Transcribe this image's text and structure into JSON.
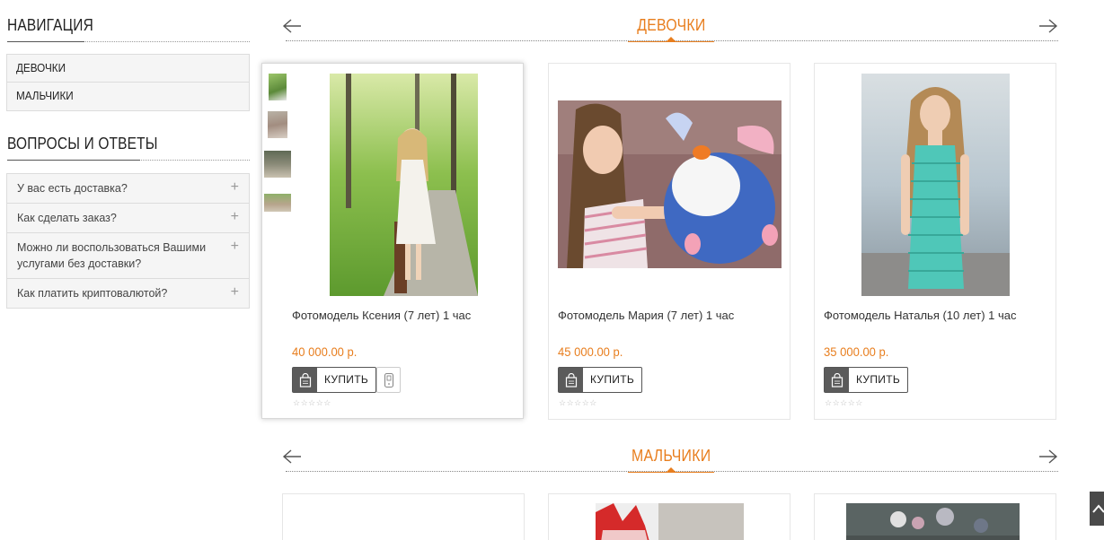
{
  "sidebar": {
    "nav_heading": "НАВИГАЦИЯ",
    "nav_items": [
      {
        "label": "ДЕВОЧКИ"
      },
      {
        "label": "МАЛЬЧИКИ"
      }
    ],
    "faq_heading": "ВОПРОСЫ И ОТВЕТЫ",
    "faq_items": [
      {
        "question": "У вас есть доставка?",
        "icon": "plus-icon"
      },
      {
        "question": "Как сделать заказ?",
        "icon": "plus-icon"
      },
      {
        "question": "Можно ли воспользоваться Вашими услугами без доставки?",
        "icon": "plus-icon"
      },
      {
        "question": "Как платить криптовалютой?",
        "icon": "plus-icon"
      }
    ]
  },
  "sections": [
    {
      "title": "ДЕВОЧКИ",
      "products": [
        {
          "name": "Фотомодель Ксения (7 лет) 1 час",
          "price": "40 000.00 р.",
          "buy_label": "КУПИТЬ",
          "rating": 0,
          "stars": "☆☆☆☆☆"
        },
        {
          "name": "Фотомодель Мария (7 лет) 1 час",
          "price": "45 000.00 р.",
          "buy_label": "КУПИТЬ",
          "rating": 0,
          "stars": "☆☆☆☆☆"
        },
        {
          "name": "Фотомодель Наталья (10 лет) 1 час",
          "price": "35 000.00 р.",
          "buy_label": "КУПИТЬ",
          "rating": 0,
          "stars": "☆☆☆☆☆"
        }
      ]
    },
    {
      "title": "МАЛЬЧИКИ",
      "products": []
    }
  ],
  "icons": {
    "prev": "arrow-left-icon",
    "next": "arrow-right-icon",
    "cart": "shopping-bag-icon",
    "compare": "compare-icon",
    "scroll_top": "chevron-up-icon"
  },
  "colors": {
    "accent": "#e87e1e",
    "button_icon_bg": "#5b5b5b",
    "sidebar_bg": "#f5f5f5"
  }
}
